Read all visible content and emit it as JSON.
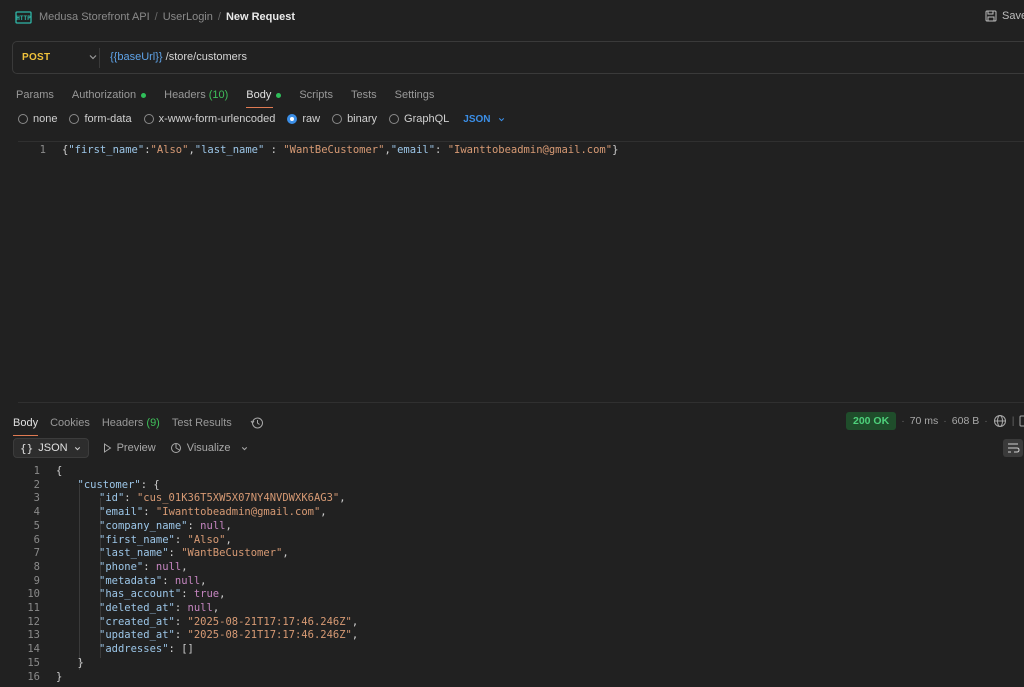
{
  "breadcrumb": {
    "collection": "Medusa Storefront API",
    "folder": "UserLogin",
    "current": "New Request",
    "separator": "/"
  },
  "save_label": "Save",
  "request": {
    "method": "POST",
    "url_variable": "{{baseUrl}}",
    "url_path": " /store/customers"
  },
  "request_tabs": [
    {
      "label": "Params"
    },
    {
      "label": "Authorization",
      "dot": true
    },
    {
      "label": "Headers",
      "count": "(10)"
    },
    {
      "label": "Body",
      "dot": true,
      "active": true
    },
    {
      "label": "Scripts"
    },
    {
      "label": "Tests"
    },
    {
      "label": "Settings"
    }
  ],
  "body_types": [
    {
      "label": "none",
      "checked": false
    },
    {
      "label": "form-data",
      "checked": false
    },
    {
      "label": "x-www-form-urlencoded",
      "checked": false
    },
    {
      "label": "raw",
      "checked": true
    },
    {
      "label": "binary",
      "checked": false
    },
    {
      "label": "GraphQL",
      "checked": false
    }
  ],
  "body_format": "JSON",
  "request_body": {
    "line_number": "1",
    "tokens": [
      {
        "t": "{",
        "c": "c-punc"
      },
      {
        "t": "\"first_name\"",
        "c": "c-key"
      },
      {
        "t": ":",
        "c": "c-punc"
      },
      {
        "t": "\"Also\"",
        "c": "c-str"
      },
      {
        "t": ",",
        "c": "c-punc"
      },
      {
        "t": "\"last_name\"",
        "c": "c-key"
      },
      {
        "t": " : ",
        "c": "c-punc"
      },
      {
        "t": "\"WantBeCustomer\"",
        "c": "c-str"
      },
      {
        "t": ",",
        "c": "c-punc"
      },
      {
        "t": "\"email\"",
        "c": "c-key"
      },
      {
        "t": ": ",
        "c": "c-punc"
      },
      {
        "t": "\"Iwanttobeadmin@gmail.com\"",
        "c": "c-str"
      },
      {
        "t": "}",
        "c": "c-punc"
      }
    ]
  },
  "response_tabs": [
    {
      "label": "Body",
      "active": true
    },
    {
      "label": "Cookies"
    },
    {
      "label": "Headers",
      "count": "(9)"
    },
    {
      "label": "Test Results"
    }
  ],
  "response_meta": {
    "status": "200 OK",
    "time": "70 ms",
    "size": "608 B"
  },
  "response_toolbar": {
    "format": "JSON",
    "preview": "Preview",
    "visualize": "Visualize"
  },
  "response_lines": [
    {
      "n": "1",
      "indent": 0,
      "tokens": [
        {
          "t": "{",
          "c": "c-punc"
        }
      ]
    },
    {
      "n": "2",
      "indent": 1,
      "tokens": [
        {
          "t": "\"customer\"",
          "c": "c-key"
        },
        {
          "t": ": {",
          "c": "c-punc"
        }
      ]
    },
    {
      "n": "3",
      "indent": 2,
      "tokens": [
        {
          "t": "\"id\"",
          "c": "c-key"
        },
        {
          "t": ": ",
          "c": "c-punc"
        },
        {
          "t": "\"cus_01K36T5XW5X07NY4NVDWXK6AG3\"",
          "c": "c-str"
        },
        {
          "t": ",",
          "c": "c-punc"
        }
      ]
    },
    {
      "n": "4",
      "indent": 2,
      "tokens": [
        {
          "t": "\"email\"",
          "c": "c-key"
        },
        {
          "t": ": ",
          "c": "c-punc"
        },
        {
          "t": "\"Iwanttobeadmin@gmail.com\"",
          "c": "c-str"
        },
        {
          "t": ",",
          "c": "c-punc"
        }
      ]
    },
    {
      "n": "5",
      "indent": 2,
      "tokens": [
        {
          "t": "\"company_name\"",
          "c": "c-key"
        },
        {
          "t": ": ",
          "c": "c-punc"
        },
        {
          "t": "null",
          "c": "c-null"
        },
        {
          "t": ",",
          "c": "c-punc"
        }
      ]
    },
    {
      "n": "6",
      "indent": 2,
      "tokens": [
        {
          "t": "\"first_name\"",
          "c": "c-key"
        },
        {
          "t": ": ",
          "c": "c-punc"
        },
        {
          "t": "\"Also\"",
          "c": "c-str"
        },
        {
          "t": ",",
          "c": "c-punc"
        }
      ]
    },
    {
      "n": "7",
      "indent": 2,
      "tokens": [
        {
          "t": "\"last_name\"",
          "c": "c-key"
        },
        {
          "t": ": ",
          "c": "c-punc"
        },
        {
          "t": "\"WantBeCustomer\"",
          "c": "c-str"
        },
        {
          "t": ",",
          "c": "c-punc"
        }
      ]
    },
    {
      "n": "8",
      "indent": 2,
      "tokens": [
        {
          "t": "\"phone\"",
          "c": "c-key"
        },
        {
          "t": ": ",
          "c": "c-punc"
        },
        {
          "t": "null",
          "c": "c-null"
        },
        {
          "t": ",",
          "c": "c-punc"
        }
      ]
    },
    {
      "n": "9",
      "indent": 2,
      "tokens": [
        {
          "t": "\"metadata\"",
          "c": "c-key"
        },
        {
          "t": ": ",
          "c": "c-punc"
        },
        {
          "t": "null",
          "c": "c-null"
        },
        {
          "t": ",",
          "c": "c-punc"
        }
      ]
    },
    {
      "n": "10",
      "indent": 2,
      "tokens": [
        {
          "t": "\"has_account\"",
          "c": "c-key"
        },
        {
          "t": ": ",
          "c": "c-punc"
        },
        {
          "t": "true",
          "c": "c-bool"
        },
        {
          "t": ",",
          "c": "c-punc"
        }
      ]
    },
    {
      "n": "11",
      "indent": 2,
      "tokens": [
        {
          "t": "\"deleted_at\"",
          "c": "c-key"
        },
        {
          "t": ": ",
          "c": "c-punc"
        },
        {
          "t": "null",
          "c": "c-null"
        },
        {
          "t": ",",
          "c": "c-punc"
        }
      ]
    },
    {
      "n": "12",
      "indent": 2,
      "tokens": [
        {
          "t": "\"created_at\"",
          "c": "c-key"
        },
        {
          "t": ": ",
          "c": "c-punc"
        },
        {
          "t": "\"2025-08-21T17:17:46.246Z\"",
          "c": "c-str"
        },
        {
          "t": ",",
          "c": "c-punc"
        }
      ]
    },
    {
      "n": "13",
      "indent": 2,
      "tokens": [
        {
          "t": "\"updated_at\"",
          "c": "c-key"
        },
        {
          "t": ": ",
          "c": "c-punc"
        },
        {
          "t": "\"2025-08-21T17:17:46.246Z\"",
          "c": "c-str"
        },
        {
          "t": ",",
          "c": "c-punc"
        }
      ]
    },
    {
      "n": "14",
      "indent": 2,
      "tokens": [
        {
          "t": "\"addresses\"",
          "c": "c-key"
        },
        {
          "t": ": []",
          "c": "c-punc"
        }
      ]
    },
    {
      "n": "15",
      "indent": 1,
      "tokens": [
        {
          "t": "}",
          "c": "c-punc"
        }
      ]
    },
    {
      "n": "16",
      "indent": 0,
      "tokens": [
        {
          "t": "}",
          "c": "c-punc"
        }
      ]
    }
  ],
  "colors": {
    "background": "#212121",
    "method": "#f0c23b",
    "accent_blue": "#3b8ee6",
    "status_green": "#4ed17b",
    "active_tab_underline": "#e07b53"
  }
}
